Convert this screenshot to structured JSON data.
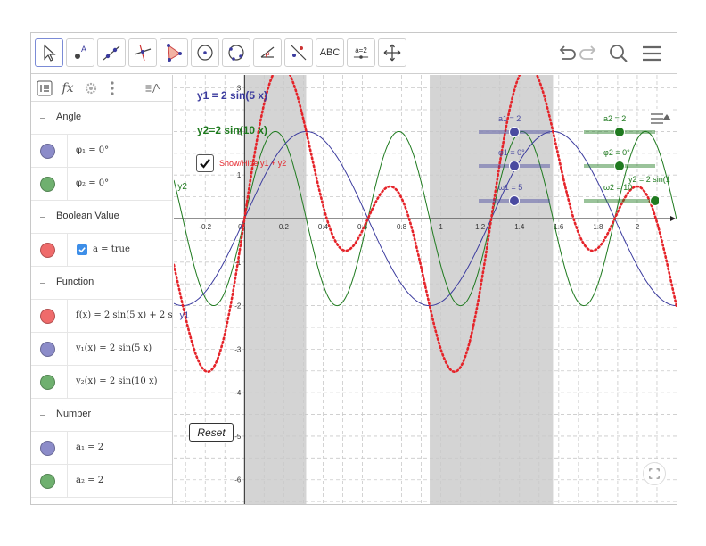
{
  "toolbar": {
    "tools": [
      {
        "name": "move-tool",
        "selected": true
      },
      {
        "name": "point-tool"
      },
      {
        "name": "line-tool"
      },
      {
        "name": "perpendicular-line-tool"
      },
      {
        "name": "polygon-tool"
      },
      {
        "name": "circle-with-center-tool"
      },
      {
        "name": "circle-through-three-points-tool"
      },
      {
        "name": "angle-tool"
      },
      {
        "name": "reflect-about-line-tool"
      },
      {
        "name": "text-tool",
        "label": "ABC"
      },
      {
        "name": "slider-tool",
        "label": "a=2"
      },
      {
        "name": "move-graphics-view-tool"
      }
    ],
    "right_icons": [
      "undo-icon",
      "redo-icon",
      "search-icon",
      "menu-icon"
    ]
  },
  "algebra": {
    "header_icons": [
      "algebra-sort-icon",
      "input-bar-icon",
      "algebra-settings-icon",
      "algebra-more-icon",
      "algebra-description-icon"
    ],
    "input_icon_label": "fx",
    "items": [
      {
        "type": "group",
        "label": "Angle"
      },
      {
        "type": "item",
        "color": "#8c8cc9",
        "text": "φ₁ = 0°"
      },
      {
        "type": "item",
        "color": "#6fb06f",
        "text": "φ₂ = 0°"
      },
      {
        "type": "group",
        "label": "Boolean Value"
      },
      {
        "type": "bool",
        "color": "#ef6b6b",
        "text": "a = true"
      },
      {
        "type": "group",
        "label": "Function"
      },
      {
        "type": "item",
        "color": "#ef6b6b",
        "text": "f(x) = 2 sin(5 x) + 2 sin"
      },
      {
        "type": "item",
        "color": "#8c8cc9",
        "text": "y₁(x) = 2 sin(5 x)"
      },
      {
        "type": "item",
        "color": "#6fb06f",
        "text": "y₂(x) = 2 sin(10 x)"
      },
      {
        "type": "group",
        "label": "Number"
      },
      {
        "type": "item",
        "color": "#8c8cc9",
        "text": "a₁ = 2"
      },
      {
        "type": "item",
        "color": "#6fb06f",
        "text": "a₂ = 2"
      }
    ]
  },
  "graphics": {
    "colors": {
      "y1": "#3b3b9e",
      "y2": "#1e7a1e",
      "f": "#e5242a",
      "shade": "#d4d4d4",
      "slider_blue": "#4a4aa0",
      "slider_green": "#1f7a1f"
    },
    "x_range": [
      -0.36,
      2.2
    ],
    "y_range": [
      -6.6,
      3.3
    ],
    "x_ticks": [
      "-0.2",
      "0",
      "0.2",
      "0.4",
      "0.6",
      "0.8",
      "1",
      "1.2",
      "1.4",
      "1.6",
      "1.8",
      "2"
    ],
    "y_ticks": [
      "3",
      "2",
      "1",
      "-1",
      "-2",
      "-3",
      "-4",
      "-5",
      "-6"
    ],
    "shaded_intervals": [
      [
        0,
        0.314
      ],
      [
        0.943,
        1.571
      ]
    ],
    "functions": {
      "y1": {
        "amplitude": 2,
        "omega": 5
      },
      "y2": {
        "amplitude": 2,
        "omega": 10
      },
      "f": "y1 + y2"
    },
    "curve_labels": [
      {
        "key": "y2",
        "text": "y2"
      },
      {
        "key": "y1",
        "text": "y1"
      }
    ],
    "equation_labels": [
      {
        "key": "y1",
        "text": "y1 = 2 sin(5 x)"
      },
      {
        "key": "y2",
        "text": "y2=2 sin(10 x)"
      }
    ],
    "checkbox": {
      "checked": true,
      "label": "Show/Hide  y1 + y2"
    },
    "reset_label": "Reset",
    "sliders": [
      {
        "name": "slider-a1",
        "label": "a1 = 2",
        "color": "blue",
        "value": 2
      },
      {
        "name": "slider-phi1",
        "label": "φ1 = 0°",
        "color": "blue",
        "value": 0
      },
      {
        "name": "slider-omega1",
        "label": "ω1 = 5",
        "color": "blue",
        "value": 5
      },
      {
        "name": "slider-a2",
        "label": "a2 = 2",
        "color": "green",
        "value": 2
      },
      {
        "name": "slider-phi2",
        "label": "φ2 = 0°",
        "color": "green",
        "value": 0
      },
      {
        "name": "slider-omega2",
        "label": "ω2 = 10",
        "color": "green",
        "value": 10
      }
    ],
    "cut_label": "y2 = 2 sin(1"
  }
}
